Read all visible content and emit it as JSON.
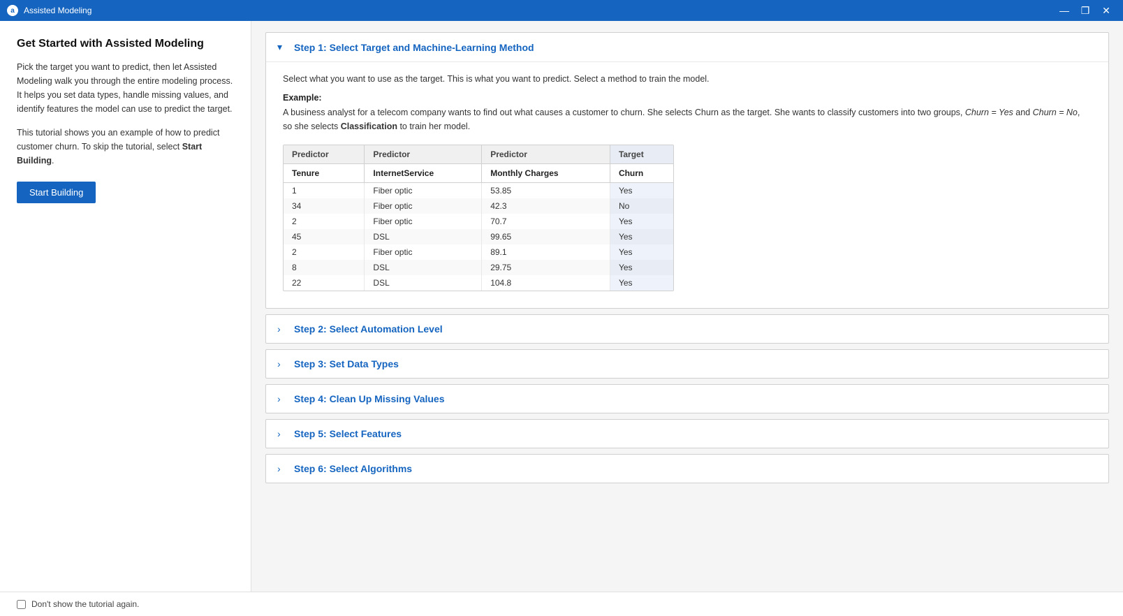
{
  "titleBar": {
    "icon": "a",
    "title": "Assisted Modeling",
    "minimize": "—",
    "restore": "❐",
    "close": "✕"
  },
  "sidebar": {
    "title": "Get Started with Assisted Modeling",
    "description": "Pick the target you want to predict, then let Assisted Modeling walk you through the entire modeling process. It helps you set data types, handle missing values, and identify features the model can use to predict the target.",
    "tutorial": "This tutorial shows you an example of how to predict customer churn. To skip the tutorial, select ",
    "tutorialBold": "Start Building",
    "tutorialEnd": ".",
    "startButton": "Start Building"
  },
  "steps": [
    {
      "id": 1,
      "label": "Step 1: Select Target and Machine-Learning Method",
      "expanded": true,
      "chevron": "▾"
    },
    {
      "id": 2,
      "label": "Step 2: Select Automation Level",
      "expanded": false,
      "chevron": "›"
    },
    {
      "id": 3,
      "label": "Step 3: Set Data Types",
      "expanded": false,
      "chevron": "›"
    },
    {
      "id": 4,
      "label": "Step 4: Clean Up Missing Values",
      "expanded": false,
      "chevron": "›"
    },
    {
      "id": 5,
      "label": "Step 5: Select Features",
      "expanded": false,
      "chevron": "›"
    },
    {
      "id": 6,
      "label": "Step 6: Select Algorithms",
      "expanded": false,
      "chevron": "›"
    }
  ],
  "step1": {
    "description": "Select what you want to use as the target. This is what you want to predict. Select a method to train the model.",
    "exampleLabel": "Example:",
    "exampleText1": "A business analyst for a telecom company wants to find out what causes a customer to churn. She selects Churn as the target. She wants to classify customers into two groups, ",
    "exampleItalic1": "Churn = Yes",
    "exampleText2": " and ",
    "exampleItalic2": "Churn = No",
    "exampleText3": ", so she selects ",
    "exampleBold": "Classification",
    "exampleText4": " to train her model.",
    "table": {
      "columns": [
        {
          "id": "predictor1",
          "header": "Predictor",
          "subheader": "Tenure",
          "isTarget": false
        },
        {
          "id": "predictor2",
          "header": "Predictor",
          "subheader": "InternetService",
          "isTarget": false
        },
        {
          "id": "predictor3",
          "header": "Predictor",
          "subheader": "Monthly Charges",
          "isTarget": false
        },
        {
          "id": "target",
          "header": "Target",
          "subheader": "Churn",
          "isTarget": true
        }
      ],
      "rows": [
        [
          "1",
          "Fiber optic",
          "53.85",
          "Yes"
        ],
        [
          "34",
          "Fiber optic",
          "42.3",
          "No"
        ],
        [
          "2",
          "Fiber optic",
          "70.7",
          "Yes"
        ],
        [
          "45",
          "DSL",
          "99.65",
          "Yes"
        ],
        [
          "2",
          "Fiber optic",
          "89.1",
          "Yes"
        ],
        [
          "8",
          "DSL",
          "29.75",
          "Yes"
        ],
        [
          "22",
          "DSL",
          "104.8",
          "Yes"
        ]
      ]
    }
  },
  "footer": {
    "checkboxLabel": "Don't show the tutorial again."
  }
}
